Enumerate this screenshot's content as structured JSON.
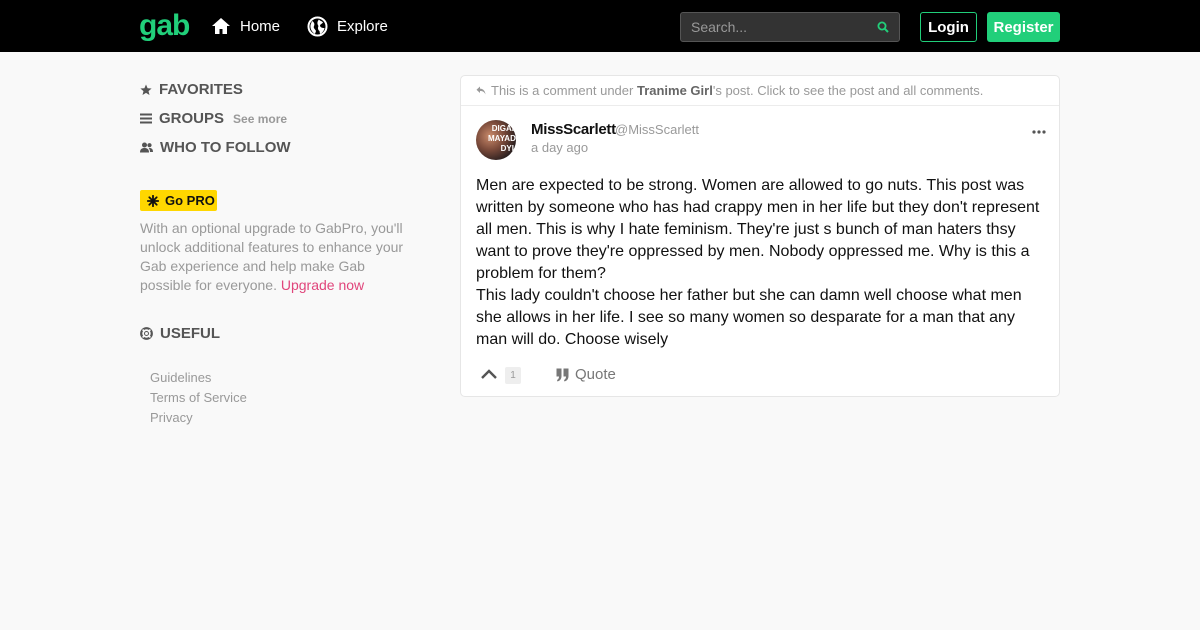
{
  "topbar": {
    "logo": "gab",
    "nav": {
      "home": "Home",
      "explore": "Explore"
    },
    "search": {
      "placeholder": "Search..."
    },
    "login_label": "Login",
    "register_label": "Register"
  },
  "sidebar": {
    "favorites": "FAVORITES",
    "groups": "GROUPS",
    "groups_see_more": "See more",
    "who_to_follow": "WHO TO FOLLOW",
    "gopro_badge": "Go PRO",
    "pro_text": "With an optional upgrade to GabPro, you'll unlock additional features to enhance your Gab experience and help make Gab possible for everyone.",
    "pro_link": "Upgrade now",
    "useful": "USEFUL",
    "footer_links": [
      "Guidelines",
      "Terms of Service",
      "Privacy"
    ]
  },
  "post": {
    "notice_prefix": "This is a comment under",
    "notice_author": "Tranime Girl",
    "notice_suffix": "'s post. Click to see the post and all comments.",
    "author_name": "MissScarlett",
    "author_handle": "@MissScarlett",
    "avatar_text": "DIGAI MAYAD DYI",
    "timestamp": "a day ago",
    "body_lines": [
      "Men are expected to be strong. Women are allowed to go nuts. This post was written by someone who has had crappy men in her life but they don't represent all men. This is why I hate feminism. They're just s bunch of man haters thsy want to prove they're oppressed by men. Nobody oppressed me. Why is this a problem for them?",
      "This lady couldn't choose her father but she can damn well choose what men she allows in her life. I see so many women so desparate for a man that any man will do. Choose wisely"
    ],
    "score": "1",
    "quote_label": "Quote"
  },
  "colors": {
    "brand_green": "#21cf7a",
    "pro_yellow": "#ffd700",
    "link_pink": "#e0457b",
    "topbar_bg": "#000000",
    "page_bg": "#f9f9f9"
  },
  "icons": {
    "nav_home": "home-icon",
    "nav_explore": "globe-icon",
    "search": "search-icon",
    "favorites": "star-icon",
    "groups": "list-icon",
    "who_to_follow": "users-icon",
    "gopro": "asterisk-icon",
    "useful": "life-ring-icon",
    "notice": "reply-icon",
    "more": "ellipsis-icon",
    "upvote": "chevron-up-icon",
    "quote": "quote-icon"
  }
}
